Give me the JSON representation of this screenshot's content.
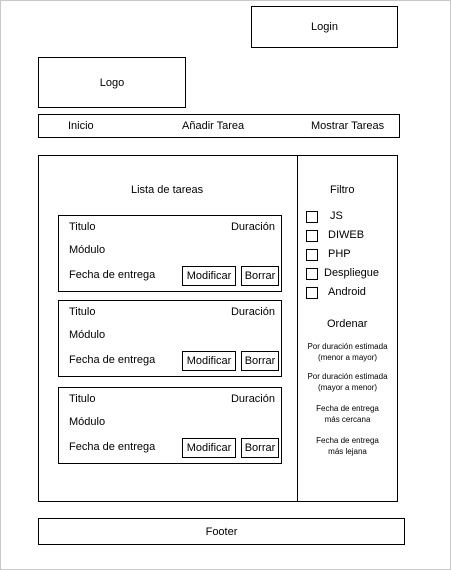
{
  "header": {
    "login_label": "Login",
    "logo_label": "Logo"
  },
  "nav": {
    "items": [
      "Inicio",
      "Añadir Tarea",
      "Mostrar Tareas"
    ]
  },
  "main": {
    "title": "Lista de tareas",
    "tasks": [
      {
        "title": "Titulo",
        "duration": "Duración",
        "module": "Módulo",
        "due": "Fecha de entrega",
        "edit_label": "Modificar",
        "delete_label": "Borrar"
      },
      {
        "title": "Titulo",
        "duration": "Duración",
        "module": "Módulo",
        "due": "Fecha de entrega",
        "edit_label": "Modificar",
        "delete_label": "Borrar"
      },
      {
        "title": "Titulo",
        "duration": "Duración",
        "module": "Módulo",
        "due": "Fecha de entrega",
        "edit_label": "Modificar",
        "delete_label": "Borrar"
      }
    ]
  },
  "sidebar": {
    "filter_title": "Filtro",
    "filters": [
      "JS",
      "DIWEB",
      "PHP",
      "Despliegue",
      "Android"
    ],
    "sort_title": "Ordenar",
    "sort_options": [
      [
        "Por duración estimada",
        "(menor a mayor)"
      ],
      [
        "Por duración estimada",
        "(mayor a menor)"
      ],
      [
        "Fecha de entrega",
        "más cercana"
      ],
      [
        "Fecha de entrega",
        "más lejana"
      ]
    ]
  },
  "footer": {
    "label": "Footer"
  }
}
